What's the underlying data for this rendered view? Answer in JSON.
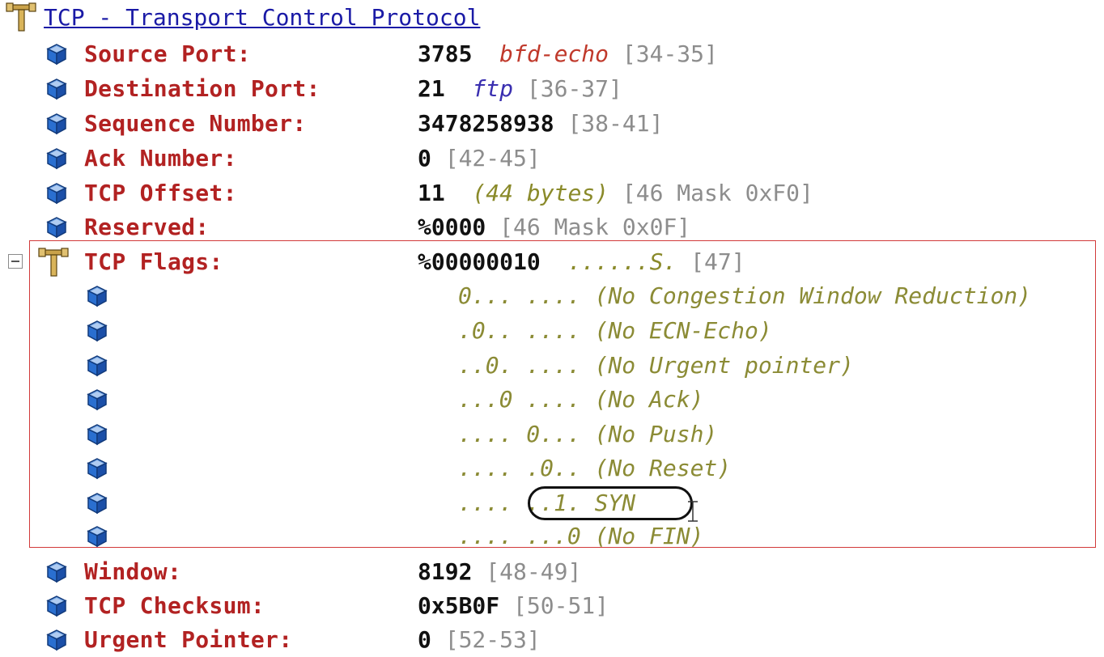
{
  "header": {
    "title": "TCP - Transport Control Protocol"
  },
  "fields": [
    {
      "label": "Source Port:",
      "value": "3785",
      "extra": "bfd-echo",
      "range": "[34-35]"
    },
    {
      "label": "Destination Port:",
      "value": "21",
      "extra": "ftp",
      "range": "[36-37]"
    },
    {
      "label": "Sequence Number:",
      "value": "3478258938",
      "range": "[38-41]"
    },
    {
      "label": "Ack Number:",
      "value": "0",
      "range": "[42-45]"
    },
    {
      "label": "TCP Offset:",
      "value": "11",
      "extra": "(44 bytes)",
      "range": "[46 Mask 0xF0]"
    },
    {
      "label": "Reserved:",
      "value": "%0000",
      "range": "[46 Mask 0x0F]"
    }
  ],
  "flags": {
    "label": "TCP Flags:",
    "value": "%00000010",
    "summary": "......S.",
    "range": "[47]",
    "bits": [
      "0... .... (No Congestion Window Reduction)",
      ".0.. .... (No ECN-Echo)",
      "..0. .... (No Urgent pointer)",
      "...0 .... (No Ack)",
      ".... 0... (No Push)",
      ".... .0.. (No Reset)",
      ".... ..1. SYN",
      ".... ...0 (No FIN)"
    ]
  },
  "after_fields": [
    {
      "label": "Window:",
      "value": "8192",
      "range": "[48-49]"
    },
    {
      "label": "TCP Checksum:",
      "value": "0x5B0F",
      "range": "[50-51]"
    },
    {
      "label": "Urgent Pointer:",
      "value": "0",
      "range": "[52-53]"
    }
  ],
  "icons": {
    "field": "cube-icon",
    "branch": "protocol-branch-icon",
    "expander": "collapse-icon"
  },
  "colors": {
    "field_label": "#b22222",
    "link": "#1a1aa6",
    "range": "#8d8d8d",
    "bits": "#8b8b35",
    "highlight_box": "#d23a3a"
  }
}
